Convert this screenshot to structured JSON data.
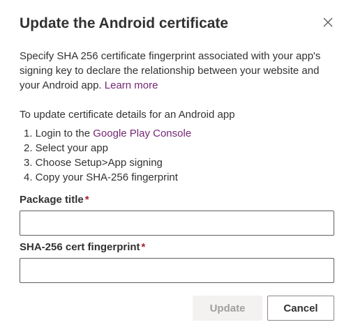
{
  "dialog": {
    "title": "Update the Android certificate",
    "description": "Specify SHA 256 certificate fingerprint associated with your app's signing key to declare the relationship between your website and your Android app.",
    "learn_more": "Learn more",
    "instructions_heading": "To update certificate details for an Android app",
    "steps": [
      {
        "prefix": "1. Login to the ",
        "link": "Google Play Console"
      },
      {
        "text": "2. Select your app"
      },
      {
        "text": "3. Choose Setup>App signing"
      },
      {
        "text": "4. Copy your SHA-256 fingerprint"
      }
    ],
    "fields": {
      "package_title": {
        "label": "Package title",
        "required_mark": "*",
        "value": ""
      },
      "fingerprint": {
        "label": "SHA-256 cert fingerprint",
        "required_mark": "*",
        "value": ""
      }
    },
    "buttons": {
      "update": "Update",
      "cancel": "Cancel"
    }
  },
  "colors": {
    "link": "#742774",
    "required": "#a4262c",
    "disabled_button_bg": "#f3f2f1",
    "disabled_button_text": "#a19f9d"
  },
  "icons": {
    "close": "close-icon"
  }
}
